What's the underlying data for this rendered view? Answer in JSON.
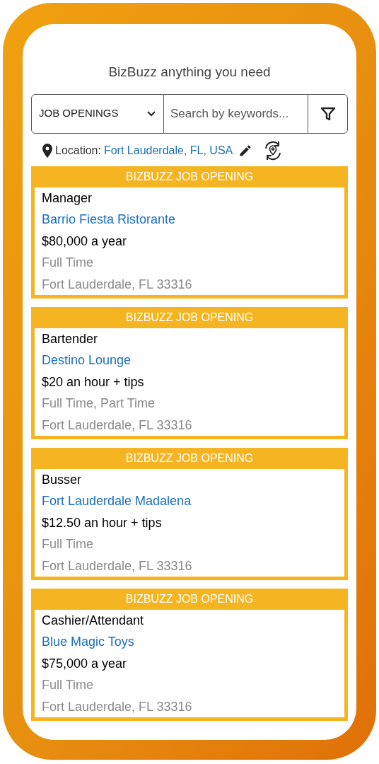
{
  "header": {
    "title": "BizBuzz anything you need"
  },
  "search": {
    "category": "JOB OPENINGS",
    "placeholder": "Search by keywords..."
  },
  "location": {
    "label": "Location:",
    "value": "Fort Lauderdale, FL, USA"
  },
  "jobs": [
    {
      "banner": "BIZBUZZ JOB OPENING",
      "title": "Manager",
      "company": "Barrio Fiesta Ristorante",
      "pay": "$80,000 a year",
      "type": "Full Time",
      "address": "Fort Lauderdale, FL 33316"
    },
    {
      "banner": "BIZBUZZ JOB OPENING",
      "title": "Bartender",
      "company": "Destino Lounge",
      "pay": "$20 an hour + tips",
      "type": "Full Time, Part Time",
      "address": "Fort Lauderdale, FL 33316"
    },
    {
      "banner": "BIZBUZZ JOB OPENING",
      "title": "Busser",
      "company": "Fort Lauderdale Madalena",
      "pay": "$12.50 an hour + tips",
      "type": "Full Time",
      "address": "Fort Lauderdale, FL 33316"
    },
    {
      "banner": "BIZBUZZ JOB OPENING",
      "title": "Cashier/Attendant",
      "company": "Blue Magic Toys",
      "pay": "$75,000 a year",
      "type": "Full Time",
      "address": "Fort Lauderdale, FL 33316"
    }
  ]
}
